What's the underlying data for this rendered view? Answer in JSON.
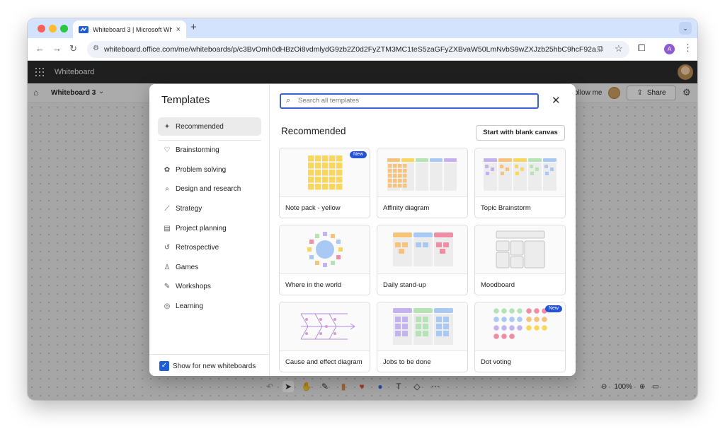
{
  "browser": {
    "tab_title": "Whiteboard 3 | Microsoft Whi",
    "tab_close": "×",
    "new_tab": "+",
    "url": "whiteboard.office.com/me/whiteboards/p/c3BvOmh0dHBzOi8vdmlydG9zb2Z0d2FyZTM3MC1teS5zaGFyZXBvaW50LmNvbS9wZXJzb25hbC9hcF92a...",
    "profile_initial": "A"
  },
  "app": {
    "name": "Whiteboard",
    "board_title": "Whiteboard 3",
    "follow_me": "ollow me",
    "share_label": "Share"
  },
  "zoom": {
    "level": "100%"
  },
  "modal": {
    "title": "Templates",
    "search_placeholder": "Search all templates",
    "section_title": "Recommended",
    "blank_canvas_label": "Start with blank canvas",
    "show_for_new_label": "Show for new whiteboards",
    "show_for_new_checked": true,
    "categories": [
      {
        "label": "Recommended",
        "icon": "sparkle-icon",
        "glyph": "✦"
      },
      {
        "label": "Brainstorming",
        "icon": "lightbulb-icon",
        "glyph": "♡"
      },
      {
        "label": "Problem solving",
        "icon": "puzzle-icon",
        "glyph": "✿"
      },
      {
        "label": "Design and research",
        "icon": "search-icon",
        "glyph": "⌕"
      },
      {
        "label": "Strategy",
        "icon": "chart-icon",
        "glyph": "⟋"
      },
      {
        "label": "Project planning",
        "icon": "calendar-icon",
        "glyph": "▤"
      },
      {
        "label": "Retrospective",
        "icon": "retro-icon",
        "glyph": "↺"
      },
      {
        "label": "Games",
        "icon": "trophy-icon",
        "glyph": "♙"
      },
      {
        "label": "Workshops",
        "icon": "wrench-icon",
        "glyph": "✎"
      },
      {
        "label": "Learning",
        "icon": "globe-icon",
        "glyph": "◎"
      }
    ],
    "templates": [
      {
        "label": "Note pack - yellow",
        "badge": "New"
      },
      {
        "label": "Affinity diagram",
        "badge": ""
      },
      {
        "label": "Topic Brainstorm",
        "badge": ""
      },
      {
        "label": "Where in the world",
        "badge": ""
      },
      {
        "label": "Daily stand-up",
        "badge": ""
      },
      {
        "label": "Moodboard",
        "badge": ""
      },
      {
        "label": "Cause and effect diagram",
        "badge": ""
      },
      {
        "label": "Jobs to be done",
        "badge": ""
      },
      {
        "label": "Dot voting",
        "badge": "New"
      }
    ]
  },
  "colors": {
    "accent": "#3b5fd9",
    "badge": "#2451d8",
    "note_yellow": "#f9d65c",
    "note_orange": "#f7c27b",
    "note_pink": "#f08ca4",
    "note_blue": "#a9c8f4",
    "note_green": "#b6e3b6",
    "note_purple": "#c4b2ef"
  }
}
